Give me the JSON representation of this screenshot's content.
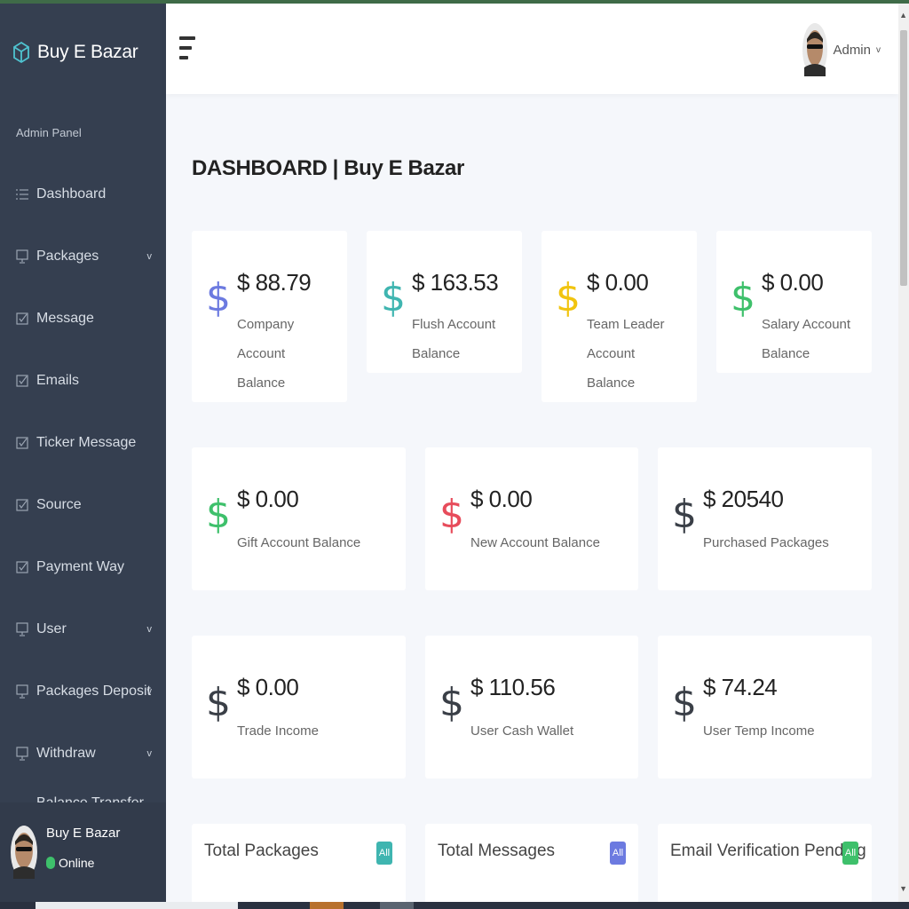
{
  "brand": {
    "name": "Buy E Bazar"
  },
  "sidebar": {
    "section_label": "Admin Panel",
    "items": [
      {
        "label": "Dashboard",
        "icon": "list-icon",
        "has_submenu": false
      },
      {
        "label": "Packages",
        "icon": "monitor-icon",
        "has_submenu": true
      },
      {
        "label": "Message",
        "icon": "checkbox-icon",
        "has_submenu": false
      },
      {
        "label": "Emails",
        "icon": "checkbox-icon",
        "has_submenu": false
      },
      {
        "label": "Ticker Message",
        "icon": "checkbox-icon",
        "has_submenu": false
      },
      {
        "label": "Source",
        "icon": "checkbox-icon",
        "has_submenu": false
      },
      {
        "label": "Payment Way",
        "icon": "checkbox-icon",
        "has_submenu": false
      },
      {
        "label": "User",
        "icon": "monitor-icon",
        "has_submenu": true
      },
      {
        "label": "Packages Deposit",
        "icon": "monitor-icon",
        "has_submenu": true
      },
      {
        "label": "Withdraw",
        "icon": "monitor-icon",
        "has_submenu": true
      },
      {
        "label": "Balance Transfer",
        "icon": "monitor-icon",
        "has_submenu": true
      }
    ],
    "user": {
      "name": "Buy E Bazar",
      "status": "Online"
    }
  },
  "header": {
    "user_label": "Admin",
    "chevron": "v"
  },
  "main": {
    "title": "DASHBOARD | Buy E Bazar",
    "row1": [
      {
        "amount": "$ 88.79",
        "label": "Company Account Balance",
        "color": "#6c7ae0"
      },
      {
        "amount": "$ 163.53",
        "label": "Flush Account Balance",
        "color": "#3fb5b0"
      },
      {
        "amount": "$ 0.00",
        "label": "Team Leader Account Balance",
        "color": "#f1c40f"
      },
      {
        "amount": "$ 0.00",
        "label": "Salary Account Balance",
        "color": "#3ec06b"
      }
    ],
    "row2": [
      {
        "amount": "$ 0.00",
        "label": "Gift Account Balance",
        "color": "#3ec06b"
      },
      {
        "amount": "$ 0.00",
        "label": "New Account Balance",
        "color": "#e74c5b"
      },
      {
        "amount": "$ 20540",
        "label": "Purchased Packages",
        "color": "#3a3f47"
      }
    ],
    "row3": [
      {
        "amount": "$ 0.00",
        "label": "Trade Income",
        "color": "#3a3f47"
      },
      {
        "amount": "$ 110.56",
        "label": "User Cash Wallet",
        "color": "#3a3f47"
      },
      {
        "amount": "$ 74.24",
        "label": "User Temp Income",
        "color": "#3a3f47"
      }
    ],
    "row4": [
      {
        "title": "Total Packages",
        "badge": "All",
        "color": "#3fb5b0"
      },
      {
        "title": "Total Messages",
        "badge": "All",
        "color": "#6c7ae0"
      },
      {
        "title": "Email Verification Pending",
        "badge": "All",
        "color": "#3ec06b"
      }
    ]
  }
}
